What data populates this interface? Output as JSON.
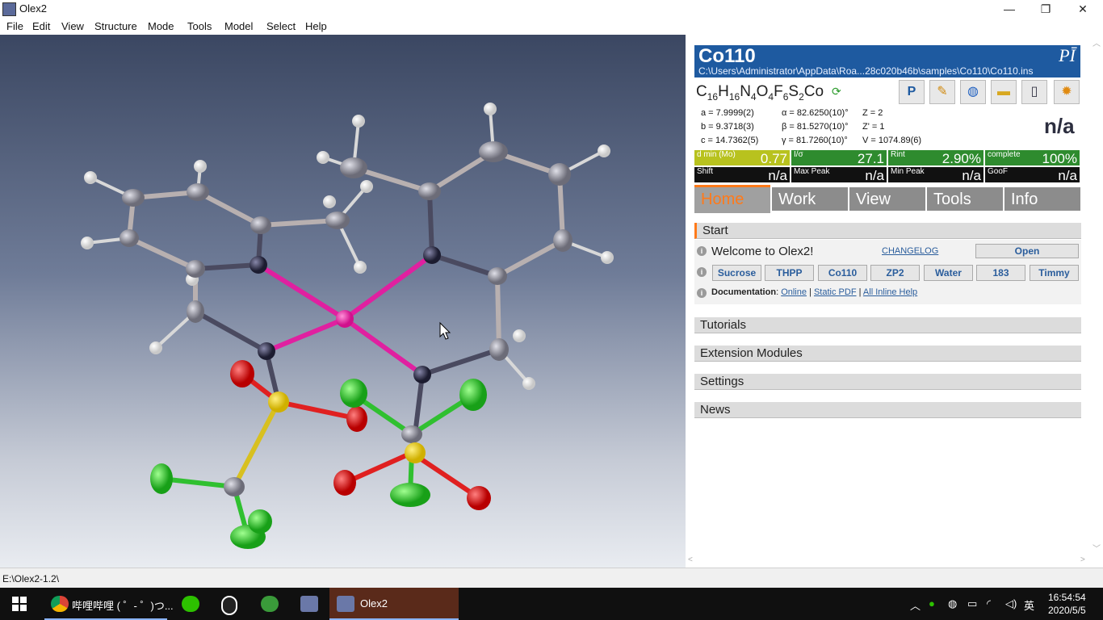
{
  "window": {
    "title": "Olex2",
    "minimize": "—",
    "maximize": "❐",
    "close": "✕"
  },
  "menu": [
    "File",
    "Edit",
    "View",
    "Structure",
    "Mode",
    "Tools",
    "Model",
    "Select",
    "Help"
  ],
  "viewport": {
    "prompt": ">>|"
  },
  "status": {
    "path": "E:\\Olex2-1.2\\"
  },
  "header": {
    "name": "Co110",
    "space_group": "PĪ",
    "path": "C:\\Users\\Administrator\\AppData\\Roa...28c020b46b\\samples\\Co110\\Co110.ins"
  },
  "formula": [
    [
      "C",
      "16"
    ],
    [
      "H",
      "16"
    ],
    [
      "N",
      "4"
    ],
    [
      "O",
      "4"
    ],
    [
      "F",
      "6"
    ],
    [
      "S",
      "2"
    ],
    [
      "Co",
      ""
    ]
  ],
  "toolbar_icons": [
    "pton-icon",
    "pencil-icon",
    "globe-icon",
    "folder-icon",
    "notepad-icon",
    "sun-settings-icon"
  ],
  "cell": {
    "rows": [
      [
        "a = 7.9999(2)",
        "α = 82.6250(10)°",
        "Z = 2"
      ],
      [
        "b = 9.3718(3)",
        "β = 81.5270(10)°",
        "Z' = 1"
      ],
      [
        "c = 14.7362(5)",
        "γ = 81.7260(10)°",
        "V = 1074.89(6)"
      ]
    ],
    "big_value": "n/a"
  },
  "stats": [
    {
      "label": "d min (Mo)",
      "value": "0.77",
      "color": "#b8c21e"
    },
    {
      "label": "I/σ",
      "value": "27.1",
      "color": "#2e8b2e"
    },
    {
      "label": "Rint",
      "value": "2.90%",
      "color": "#2e8b2e"
    },
    {
      "label": "complete",
      "value": "100%",
      "color": "#2e8b2e"
    },
    {
      "label": "Shift",
      "value": "n/a"
    },
    {
      "label": "Max Peak",
      "value": "n/a"
    },
    {
      "label": "Min Peak",
      "value": "n/a"
    },
    {
      "label": "GooF",
      "value": "n/a"
    }
  ],
  "tabs": [
    "Home",
    "Work",
    "View",
    "Tools",
    "Info"
  ],
  "start": {
    "title": "Start",
    "welcome": "Welcome to Olex2!",
    "changelog": "CHANGELOG",
    "open": "Open",
    "samples": [
      "Sucrose",
      "THPP",
      "Co110",
      "ZP2",
      "Water",
      "183",
      "Timmy"
    ],
    "doc_label": "Documentation",
    "doc_links": [
      "Online",
      "Static PDF",
      "All Inline Help"
    ]
  },
  "sections": [
    "Tutorials",
    "Extension Modules",
    "Settings",
    "News"
  ],
  "taskbar": {
    "chrome_label": "哔哩哔哩 ( ゜- ゜)つ...",
    "olex_label": "Olex2",
    "ime": "英",
    "time": "16:54:54",
    "date": "2020/5/5"
  }
}
